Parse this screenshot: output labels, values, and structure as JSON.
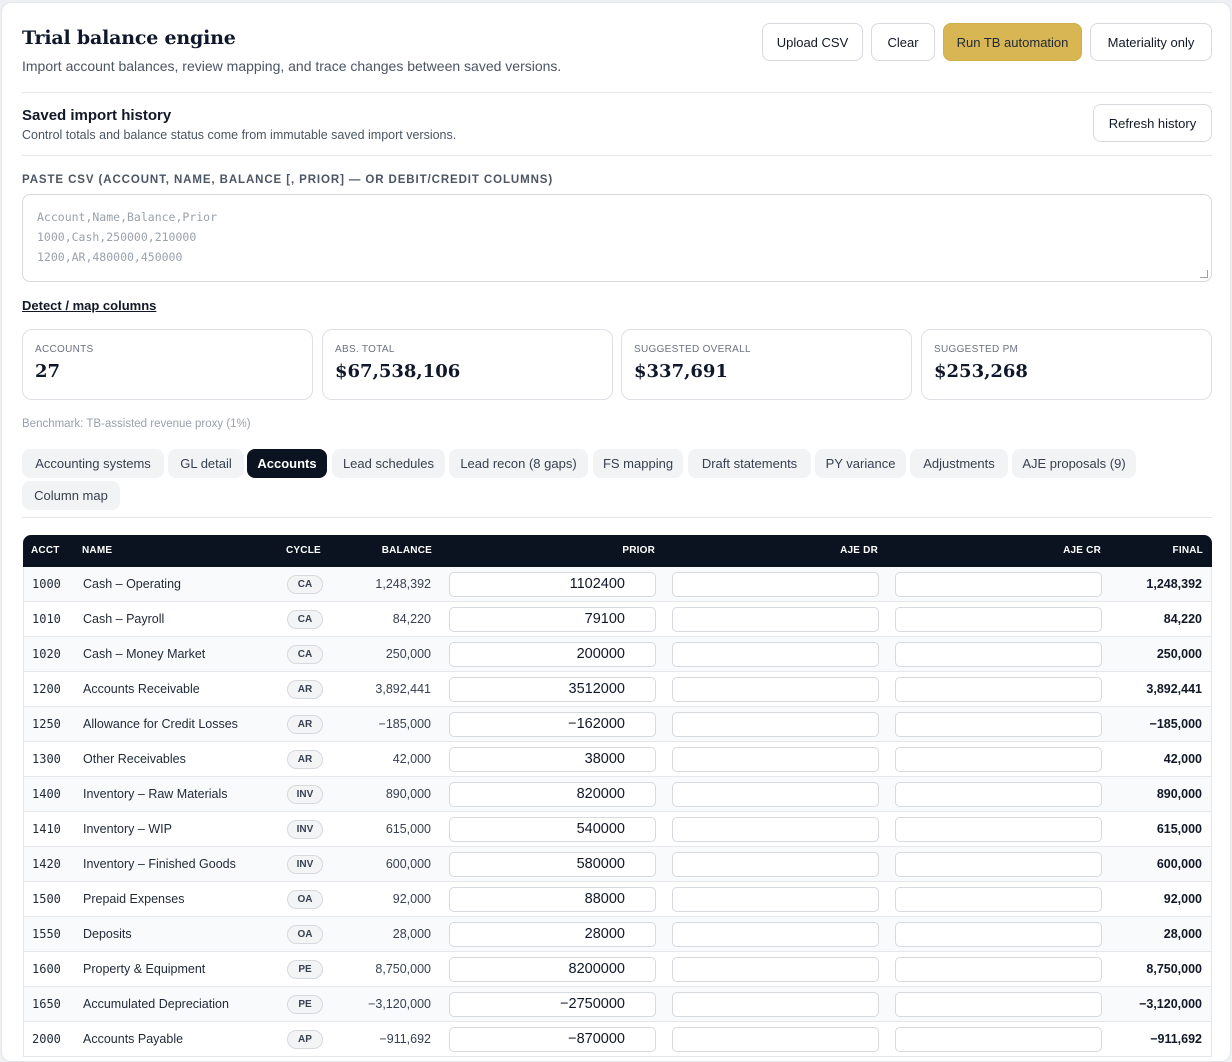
{
  "header": {
    "title": "Trial balance engine",
    "subtitle": "Import account balances, review mapping, and trace changes between saved versions.",
    "buttons": {
      "upload": "Upload CSV",
      "clear": "Clear",
      "run": "Run TB automation",
      "materiality": "Materiality only"
    }
  },
  "history": {
    "title": "Saved import history",
    "subtitle": "Control totals and balance status come from immutable saved import versions.",
    "refresh_label": "Refresh history"
  },
  "paste": {
    "label": "PASTE CSV (ACCOUNT, NAME, BALANCE [, PRIOR] — OR DEBIT/CREDIT COLUMNS)",
    "placeholder": "Account,Name,Balance,Prior\n1000,Cash,250000,210000\n1200,AR,480000,450000",
    "detect_link": "Detect / map columns"
  },
  "stats": [
    {
      "caption": "ACCOUNTS",
      "value": "27"
    },
    {
      "caption": "ABS. TOTAL",
      "value": "$67,538,106"
    },
    {
      "caption": "SUGGESTED OVERALL",
      "value": "$337,691"
    },
    {
      "caption": "SUGGESTED PM",
      "value": "$253,268"
    }
  ],
  "benchmark": "Benchmark: TB-assisted revenue proxy (1%)",
  "tabs": [
    {
      "label": "Accounting systems",
      "active": false
    },
    {
      "label": "GL detail",
      "active": false
    },
    {
      "label": "Accounts",
      "active": true
    },
    {
      "label": "Lead schedules",
      "active": false
    },
    {
      "label": "Lead recon (8 gaps)",
      "active": false
    },
    {
      "label": "FS mapping",
      "active": false
    },
    {
      "label": "Draft statements",
      "active": false
    },
    {
      "label": "PY variance",
      "active": false
    },
    {
      "label": "Adjustments",
      "active": false
    },
    {
      "label": "AJE proposals (9)",
      "active": false
    },
    {
      "label": "Column map",
      "active": false
    }
  ],
  "table": {
    "headers": {
      "acct": "ACCT",
      "name": "NAME",
      "cycle": "CYCLE",
      "balance": "BALANCE",
      "prior": "PRIOR",
      "aje_dr": "AJE DR",
      "aje_cr": "AJE CR",
      "final": "FINAL"
    },
    "rows": [
      {
        "acct": "1000",
        "name": "Cash – Operating",
        "cycle": "CA",
        "balance": "1,248,392",
        "prior": "1102400",
        "aje_dr": "",
        "aje_cr": "",
        "final": "1,248,392"
      },
      {
        "acct": "1010",
        "name": "Cash – Payroll",
        "cycle": "CA",
        "balance": "84,220",
        "prior": "79100",
        "aje_dr": "",
        "aje_cr": "",
        "final": "84,220"
      },
      {
        "acct": "1020",
        "name": "Cash – Money Market",
        "cycle": "CA",
        "balance": "250,000",
        "prior": "200000",
        "aje_dr": "",
        "aje_cr": "",
        "final": "250,000"
      },
      {
        "acct": "1200",
        "name": "Accounts Receivable",
        "cycle": "AR",
        "balance": "3,892,441",
        "prior": "3512000",
        "aje_dr": "",
        "aje_cr": "",
        "final": "3,892,441"
      },
      {
        "acct": "1250",
        "name": "Allowance for Credit Losses",
        "cycle": "AR",
        "balance": "−185,000",
        "prior": "−162000",
        "aje_dr": "",
        "aje_cr": "",
        "final": "−185,000"
      },
      {
        "acct": "1300",
        "name": "Other Receivables",
        "cycle": "AR",
        "balance": "42,000",
        "prior": "38000",
        "aje_dr": "",
        "aje_cr": "",
        "final": "42,000"
      },
      {
        "acct": "1400",
        "name": "Inventory – Raw Materials",
        "cycle": "INV",
        "balance": "890,000",
        "prior": "820000",
        "aje_dr": "",
        "aje_cr": "",
        "final": "890,000"
      },
      {
        "acct": "1410",
        "name": "Inventory – WIP",
        "cycle": "INV",
        "balance": "615,000",
        "prior": "540000",
        "aje_dr": "",
        "aje_cr": "",
        "final": "615,000"
      },
      {
        "acct": "1420",
        "name": "Inventory – Finished Goods",
        "cycle": "INV",
        "balance": "600,000",
        "prior": "580000",
        "aje_dr": "",
        "aje_cr": "",
        "final": "600,000"
      },
      {
        "acct": "1500",
        "name": "Prepaid Expenses",
        "cycle": "OA",
        "balance": "92,000",
        "prior": "88000",
        "aje_dr": "",
        "aje_cr": "",
        "final": "92,000"
      },
      {
        "acct": "1550",
        "name": "Deposits",
        "cycle": "OA",
        "balance": "28,000",
        "prior": "28000",
        "aje_dr": "",
        "aje_cr": "",
        "final": "28,000"
      },
      {
        "acct": "1600",
        "name": "Property & Equipment",
        "cycle": "PE",
        "balance": "8,750,000",
        "prior": "8200000",
        "aje_dr": "",
        "aje_cr": "",
        "final": "8,750,000"
      },
      {
        "acct": "1650",
        "name": "Accumulated Depreciation",
        "cycle": "PE",
        "balance": "−3,120,000",
        "prior": "−2750000",
        "aje_dr": "",
        "aje_cr": "",
        "final": "−3,120,000"
      },
      {
        "acct": "2000",
        "name": "Accounts Payable",
        "cycle": "AP",
        "balance": "−911,692",
        "prior": "−870000",
        "aje_dr": "",
        "aje_cr": "",
        "final": "−911,692"
      }
    ]
  },
  "colors": {
    "accent": "#d8b654",
    "dark": "#0b1320"
  }
}
